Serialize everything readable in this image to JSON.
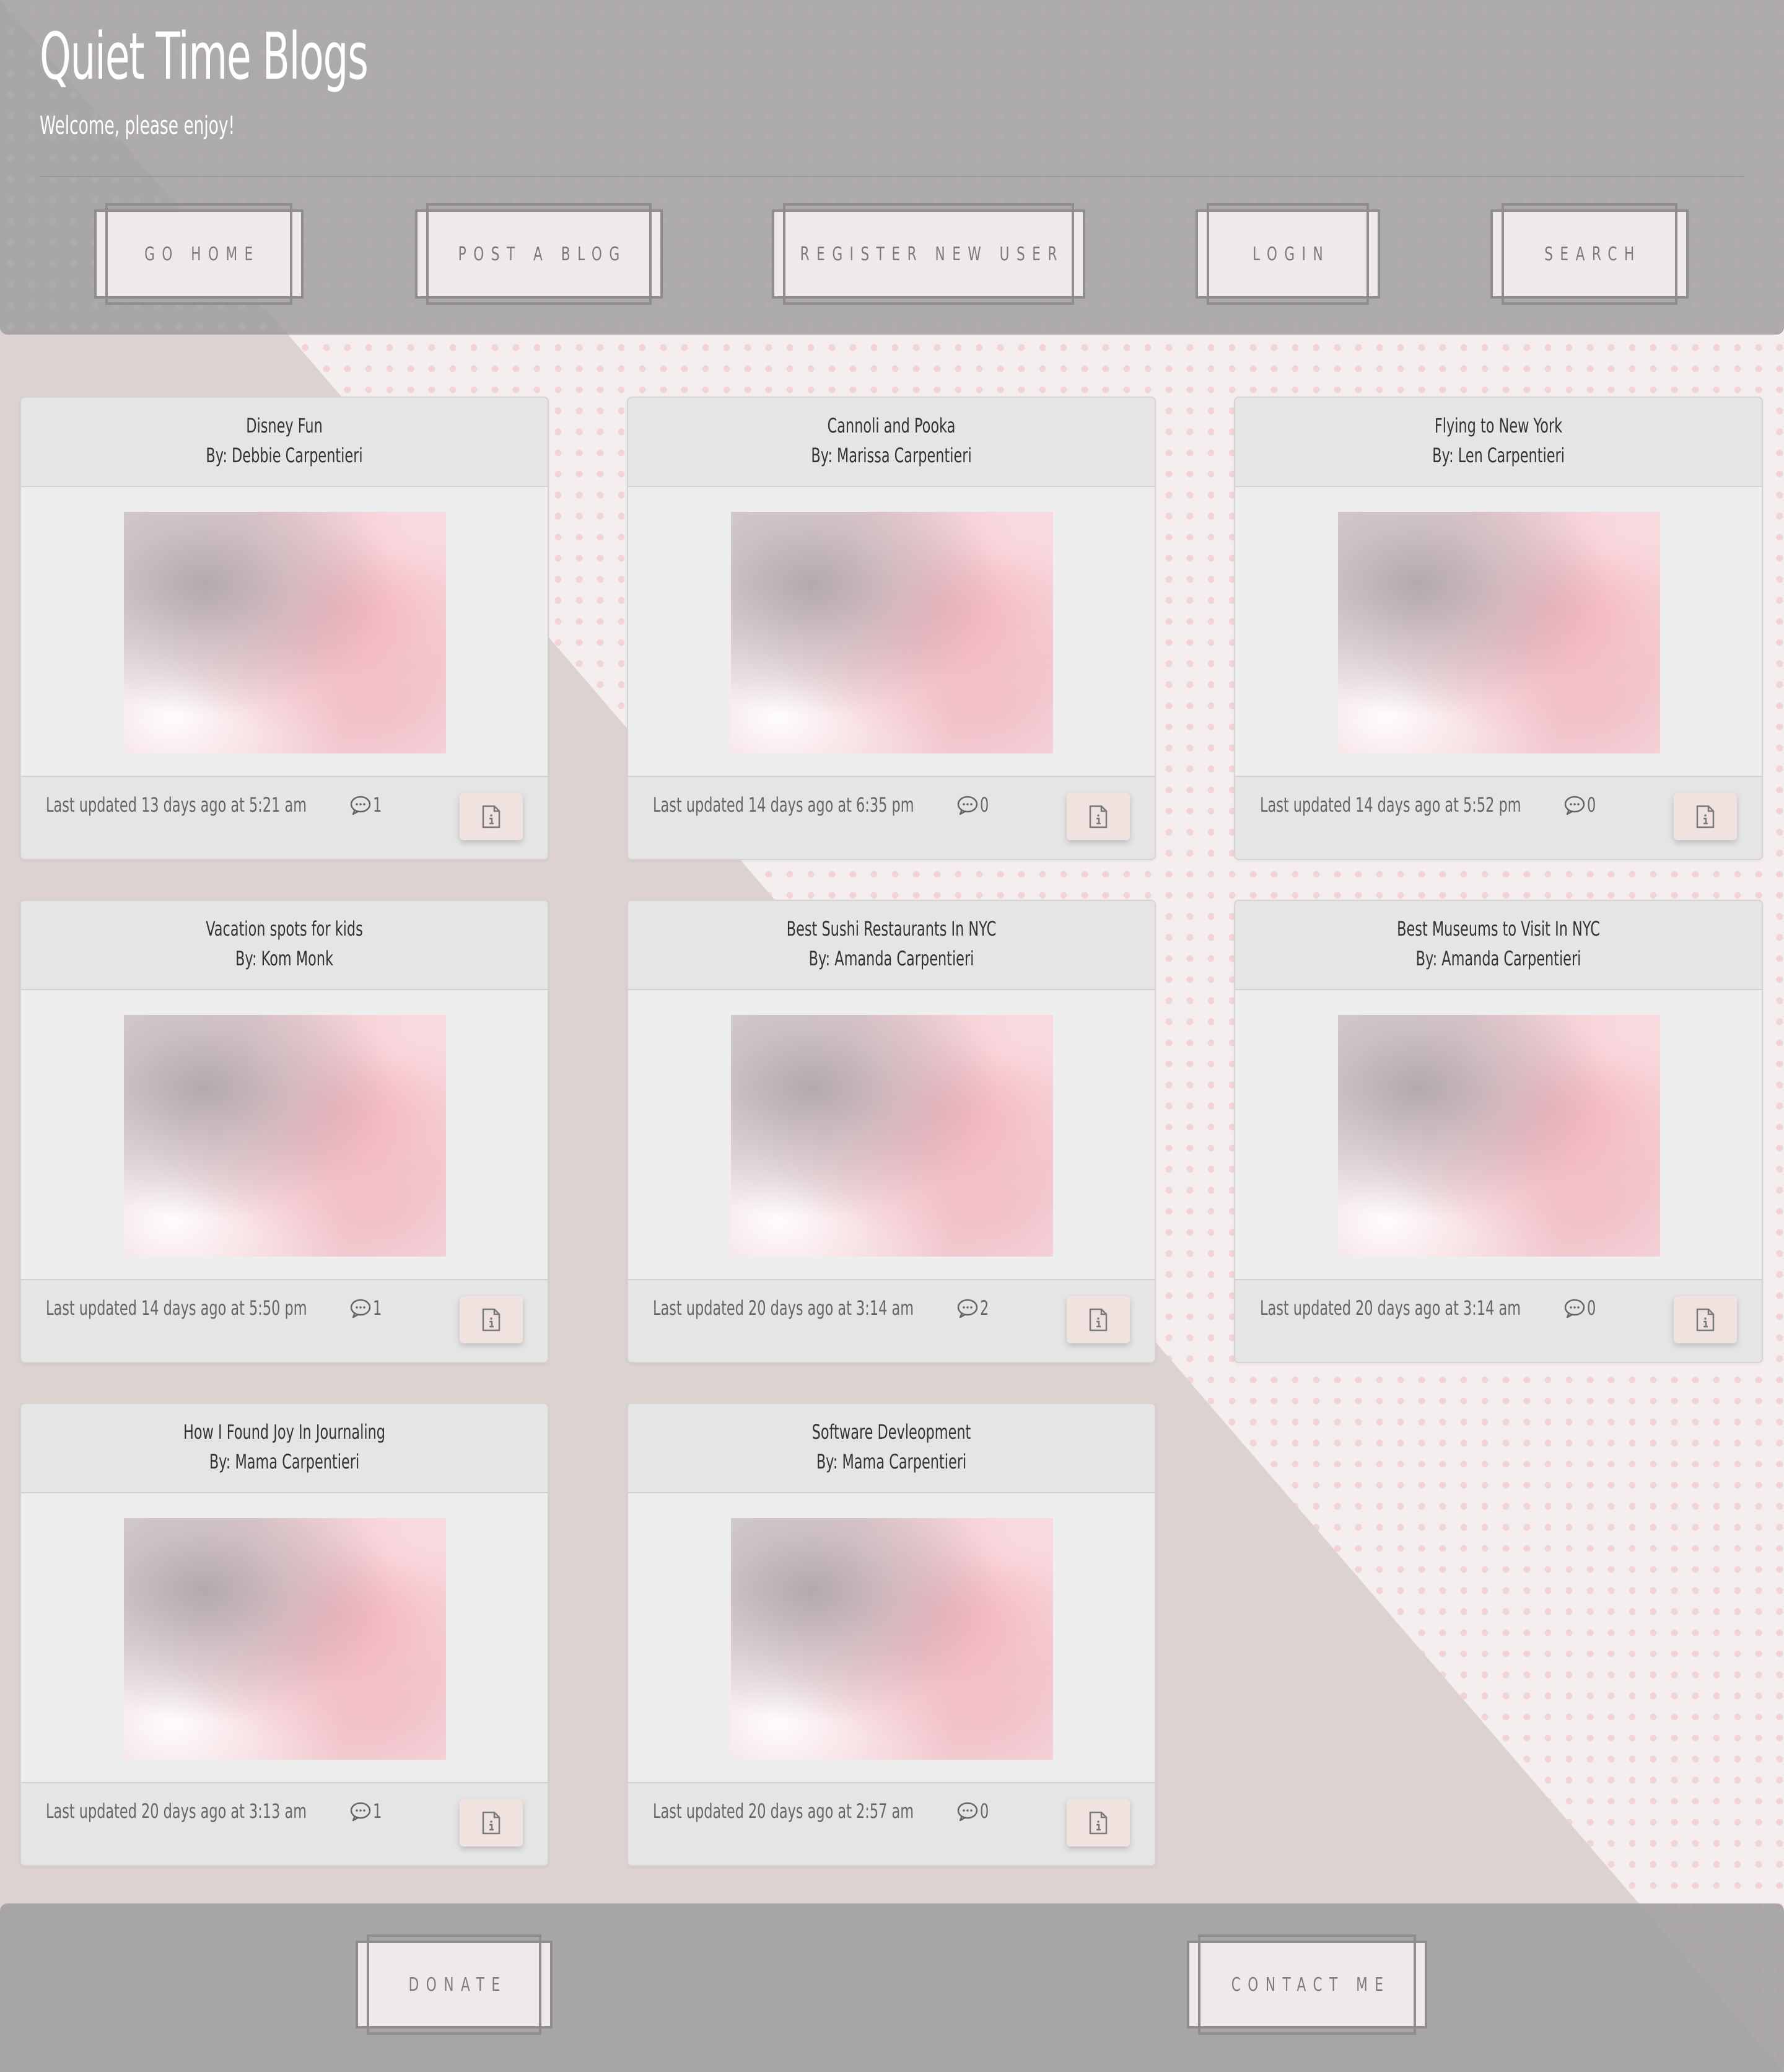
{
  "header": {
    "title": "Quiet Time Blogs",
    "subtitle": "Welcome, please enjoy!"
  },
  "nav": {
    "go_home": "GO HOME",
    "post_blog": "POST A BLOG",
    "register": "REGISTER NEW USER",
    "login": "LOGIN",
    "search": "SEARCH"
  },
  "posts": [
    {
      "title": "Disney Fun",
      "author": "By: Debbie Carpentieri",
      "updated": "Last updated 13 days ago at 5:21 am",
      "comments": "1"
    },
    {
      "title": "Cannoli and Pooka",
      "author": "By: Marissa Carpentieri",
      "updated": "Last updated 14 days ago at 6:35 pm",
      "comments": "0"
    },
    {
      "title": "Flying to New York",
      "author": "By: Len Carpentieri",
      "updated": "Last updated 14 days ago at 5:52 pm",
      "comments": "0"
    },
    {
      "title": "Vacation spots for kids",
      "author": "By: Kom Monk",
      "updated": "Last updated 14 days ago at 5:50 pm",
      "comments": "1"
    },
    {
      "title": "Best Sushi Restaurants In NYC",
      "author": "By: Amanda Carpentieri",
      "updated": "Last updated 20 days ago at 3:14 am",
      "comments": "2"
    },
    {
      "title": "Best Museums to Visit In NYC",
      "author": "By: Amanda Carpentieri",
      "updated": "Last updated 20 days ago at 3:14 am",
      "comments": "0"
    },
    {
      "title": "How I Found Joy In Journaling",
      "author": "By: Mama Carpentieri",
      "updated": "Last updated 20 days ago at 3:13 am",
      "comments": "1"
    },
    {
      "title": "Software Devleopment",
      "author": "By: Mama Carpentieri",
      "updated": "Last updated 20 days ago at 2:57 am",
      "comments": "0"
    }
  ],
  "footer": {
    "donate": "DONATE",
    "contact": "CONTACT ME"
  },
  "icons": {
    "comment": "speech-bubble-icon",
    "info": "file-info-icon"
  },
  "colors": {
    "header_bg": "#a09ea0",
    "button_bg": "#efeaea",
    "button_border": "#8f8c92",
    "card_bg": "#eeeeee",
    "info_button_bg": "#efe2df",
    "page_bg_left": "#dcd3d1",
    "page_bg_dots": "#f0bec4"
  }
}
